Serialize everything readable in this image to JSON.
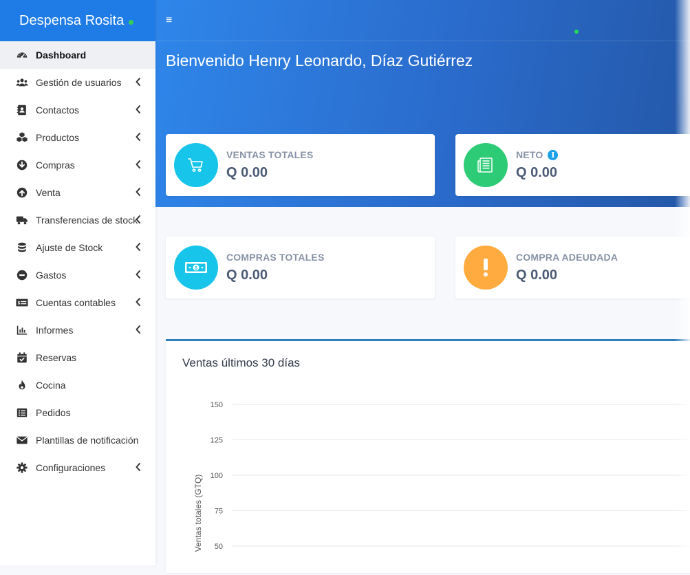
{
  "brand": {
    "name": "Despensa Rosita",
    "status_color": "#34d058"
  },
  "sidebar": {
    "items": [
      {
        "label": "Dashboard",
        "icon": "tachometer-icon",
        "active": true,
        "has_submenu": false
      },
      {
        "label": "Gestión de usuarios",
        "icon": "users-icon",
        "has_submenu": true
      },
      {
        "label": "Contactos",
        "icon": "address-book-icon",
        "has_submenu": true
      },
      {
        "label": "Productos",
        "icon": "cubes-icon",
        "has_submenu": true
      },
      {
        "label": "Compras",
        "icon": "arrow-circle-down-icon",
        "has_submenu": true
      },
      {
        "label": "Venta",
        "icon": "arrow-circle-up-icon",
        "has_submenu": true
      },
      {
        "label": "Transferencias de stock",
        "icon": "truck-icon",
        "has_submenu": true
      },
      {
        "label": "Ajuste de Stock",
        "icon": "database-icon",
        "has_submenu": true
      },
      {
        "label": "Gastos",
        "icon": "minus-circle-icon",
        "has_submenu": true
      },
      {
        "label": "Cuentas contables",
        "icon": "money-check-icon",
        "has_submenu": true
      },
      {
        "label": "Informes",
        "icon": "bar-chart-icon",
        "has_submenu": true
      },
      {
        "label": "Reservas",
        "icon": "calendar-check-icon",
        "has_submenu": false
      },
      {
        "label": "Cocina",
        "icon": "fire-icon",
        "has_submenu": false
      },
      {
        "label": "Pedidos",
        "icon": "list-alt-icon",
        "has_submenu": false
      },
      {
        "label": "Plantillas de notificación",
        "icon": "envelope-icon",
        "has_submenu": false
      },
      {
        "label": "Configuraciones",
        "icon": "gear-icon",
        "has_submenu": true
      }
    ]
  },
  "header": {
    "menu_toggle": "≡",
    "welcome": "Bienvenido Henry Leonardo, Díaz Gutiérrez"
  },
  "cards": {
    "ventas_totales": {
      "label": "VENTAS TOTALES",
      "value": "Q 0.00",
      "color": "#17c5ea"
    },
    "neto": {
      "label": "NETO",
      "info": "i",
      "value": "Q 0.00",
      "color": "#2ecb77"
    },
    "compras_totales": {
      "label": "COMPRAS TOTALES",
      "value": "Q 0.00",
      "color": "#17c5ea"
    },
    "compra_adeudada": {
      "label": "COMPRA ADEUDADA",
      "value": "Q 0.00",
      "color": "#ffab40"
    }
  },
  "sales_chart": {
    "title": "Ventas últimos 30 días",
    "ylabel": "Ventas totales (GTQ)",
    "y_ticks": [
      "150",
      "125",
      "100",
      "75",
      "50"
    ]
  },
  "chart_data": {
    "type": "line",
    "title": "Ventas últimos 30 días",
    "xlabel": "",
    "ylabel": "Ventas totales (GTQ)",
    "y_ticks": [
      150,
      125,
      100,
      75,
      50
    ],
    "ylim": [
      50,
      150
    ],
    "series": [],
    "grid": true
  }
}
